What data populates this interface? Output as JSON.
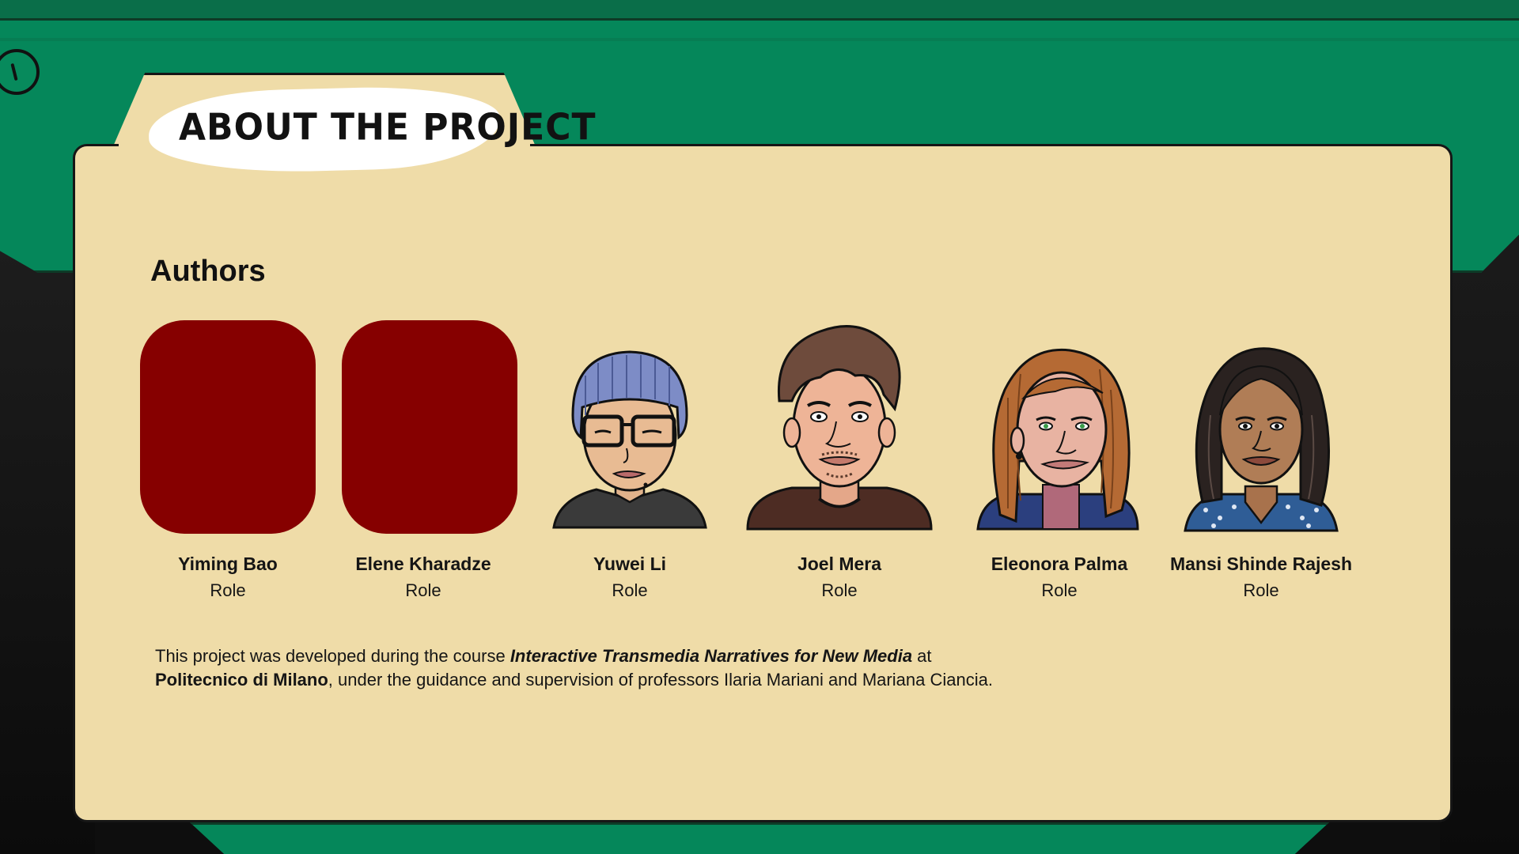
{
  "page": {
    "title": "ABOUT THE PROJECT"
  },
  "authors_section": {
    "heading": "Authors",
    "authors": [
      {
        "name": "Yiming Bao",
        "role": "Role",
        "portrait": "placeholder"
      },
      {
        "name": "Elene Kharadze",
        "role": "Role",
        "portrait": "placeholder"
      },
      {
        "name": "Yuwei Li",
        "role": "Role",
        "portrait": "illustrated-portrait"
      },
      {
        "name": "Joel Mera",
        "role": "Role",
        "portrait": "illustrated-portrait"
      },
      {
        "name": "Eleonora Palma",
        "role": "Role",
        "portrait": "illustrated-portrait"
      },
      {
        "name": "Mansi Shinde Rajesh",
        "role": "Role",
        "portrait": "illustrated-portrait"
      }
    ]
  },
  "description": {
    "prefix": "This project was developed during the course ",
    "course": "Interactive Transmedia Narratives for New Media",
    "middle": " at",
    "institution": "Politecnico di Milano",
    "suffix": ", under the guidance and supervision of professors Ilaria Mariani and Mariana Ciancia."
  },
  "colors": {
    "background_green": "#05875a",
    "paper": "#efdca8",
    "placeholder_red": "#860000",
    "ink": "#151515"
  }
}
